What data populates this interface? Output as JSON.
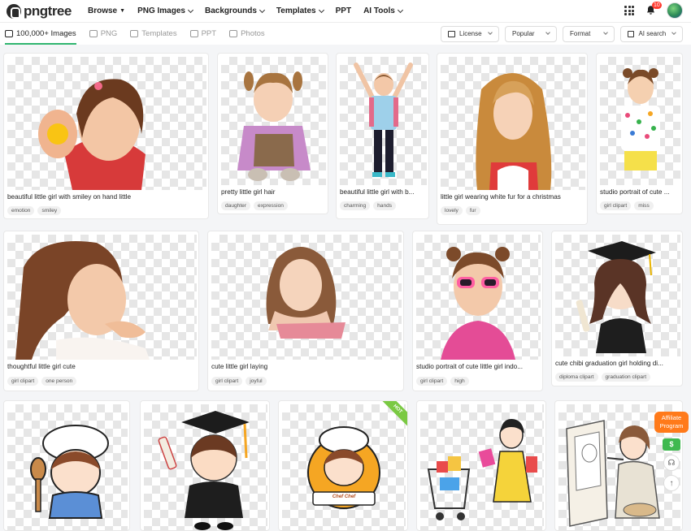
{
  "app": {
    "logo_text": "pngtree"
  },
  "nav": [
    {
      "label": "Browse",
      "indicator": "caret"
    },
    {
      "label": "PNG Images",
      "indicator": "chevron"
    },
    {
      "label": "Backgrounds",
      "indicator": "chevron"
    },
    {
      "label": "Templates",
      "indicator": "chevron"
    },
    {
      "label": "PPT",
      "indicator": "none"
    },
    {
      "label": "AI Tools",
      "indicator": "chevron"
    }
  ],
  "notifications": {
    "count": "10"
  },
  "tabs": [
    {
      "label": "100,000+ Images",
      "active": true,
      "icon": "images-icon"
    },
    {
      "label": "PNG",
      "active": false,
      "icon": "png-icon"
    },
    {
      "label": "Templates",
      "active": false,
      "icon": "templates-icon"
    },
    {
      "label": "PPT",
      "active": false,
      "icon": "ppt-icon"
    },
    {
      "label": "Photos",
      "active": false,
      "icon": "photos-icon"
    }
  ],
  "filters": {
    "license": "License",
    "sort": "Popular",
    "format": "Format",
    "ai_search": "AI search"
  },
  "cards": [
    {
      "title": "beautiful little girl with smiley on hand little",
      "tags": [
        "emotion",
        "smiley"
      ]
    },
    {
      "title": "pretty little girl hair",
      "tags": [
        "daughter",
        "expression"
      ]
    },
    {
      "title": "beautiful little girl with b...",
      "tags": [
        "charming",
        "hands"
      ]
    },
    {
      "title": "little girl wearing white fur for a christmas",
      "tags": [
        "lovely",
        "fur"
      ]
    },
    {
      "title": "studio portrait of cute ...",
      "tags": [
        "girl clipart",
        "miss"
      ]
    },
    {
      "title": "thoughtful little girl cute",
      "tags": [
        "girl clipart",
        "one person"
      ]
    },
    {
      "title": "cute little girl laying",
      "tags": [
        "girl clipart",
        "joyful"
      ]
    },
    {
      "title": "studio portrait of cute little girl indo...",
      "tags": [
        "girl clipart",
        "high"
      ]
    },
    {
      "title": "cute chibi graduation girl holding di...",
      "tags": [
        "diploma clipart",
        "graduation clipart"
      ]
    },
    {
      "title": "",
      "tags": []
    },
    {
      "title": "",
      "tags": []
    },
    {
      "title": "",
      "tags": [],
      "hot": "HOT",
      "logo_text": "Chef Chef"
    },
    {
      "title": "",
      "tags": []
    },
    {
      "title": "",
      "tags": []
    }
  ],
  "side": {
    "affiliate_line1": "Affiliate",
    "affiliate_line2": "Program",
    "cash_symbol": "$"
  },
  "colors": {
    "accent": "#2fb56f",
    "badge": "#ff3b30",
    "affiliate": "#ff7a1a",
    "hot": "#7ac943"
  }
}
